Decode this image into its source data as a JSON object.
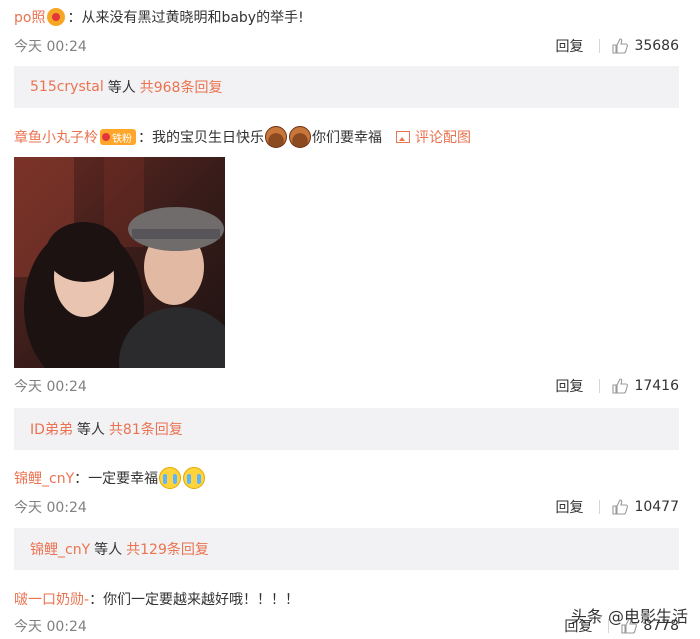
{
  "comments": [
    {
      "user": "po照",
      "text": "从来没有黑过黄晓明和baby的举手!",
      "time": "今天 00:24",
      "reply": "回复",
      "likes": "35686"
    },
    {
      "user": "章鱼小丸子柃",
      "badge": "铁粉",
      "text_a": "我的宝贝生日快乐",
      "text_b": "你们要幸福",
      "pic_link": "评论配图",
      "time": "今天 00:24",
      "reply": "回复",
      "likes": "17416"
    },
    {
      "user": "锦鲤_cnY",
      "text": "一定要幸福",
      "time": "今天 00:24",
      "reply": "回复",
      "likes": "10477"
    },
    {
      "user": "啵一口奶勋-",
      "text": "你们一定要越来越好哦！！！！",
      "time": "今天 00:24",
      "reply": "回复",
      "likes": "8778"
    }
  ],
  "subreplies": [
    {
      "user": "515crystal",
      "mid": "等人",
      "count": "共968条回复"
    },
    {
      "user": "ID弟弟",
      "mid": "等人",
      "count": "共81条回复"
    },
    {
      "user": "锦鲤_cnY",
      "mid": "等人",
      "count": "共129条回复"
    }
  ],
  "colon": "：",
  "watermark": "头条 @电影生活",
  "colors": {
    "accent": "#eb7350",
    "subbox": "#f2f2f5",
    "meta": "#808080"
  }
}
